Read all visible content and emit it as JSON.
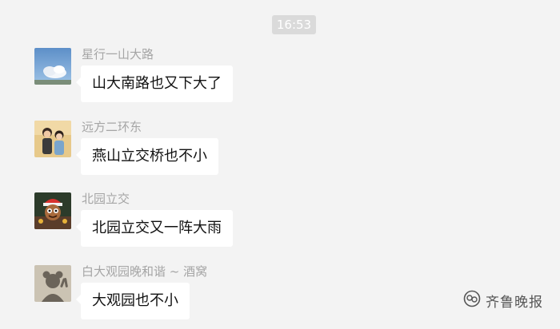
{
  "timestamp": "16:53",
  "messages": [
    {
      "sender": "星行一山大路",
      "text": "山大南路也又下大了",
      "avatar": "sky-cloud-avatar"
    },
    {
      "sender": "远方二环东",
      "text": "燕山立交桥也不小",
      "avatar": "couple-photo-avatar"
    },
    {
      "sender": "北园立交",
      "text": "北园立交又一阵大雨",
      "avatar": "cartoon-character-avatar"
    },
    {
      "sender": "白大观园晚和谐 ~ 酒窝",
      "text": "大观园也不小",
      "avatar": "silhouette-avatar"
    }
  ],
  "watermark": {
    "text": "齐鲁晚报",
    "icon": "wechat-official-account-icon"
  }
}
